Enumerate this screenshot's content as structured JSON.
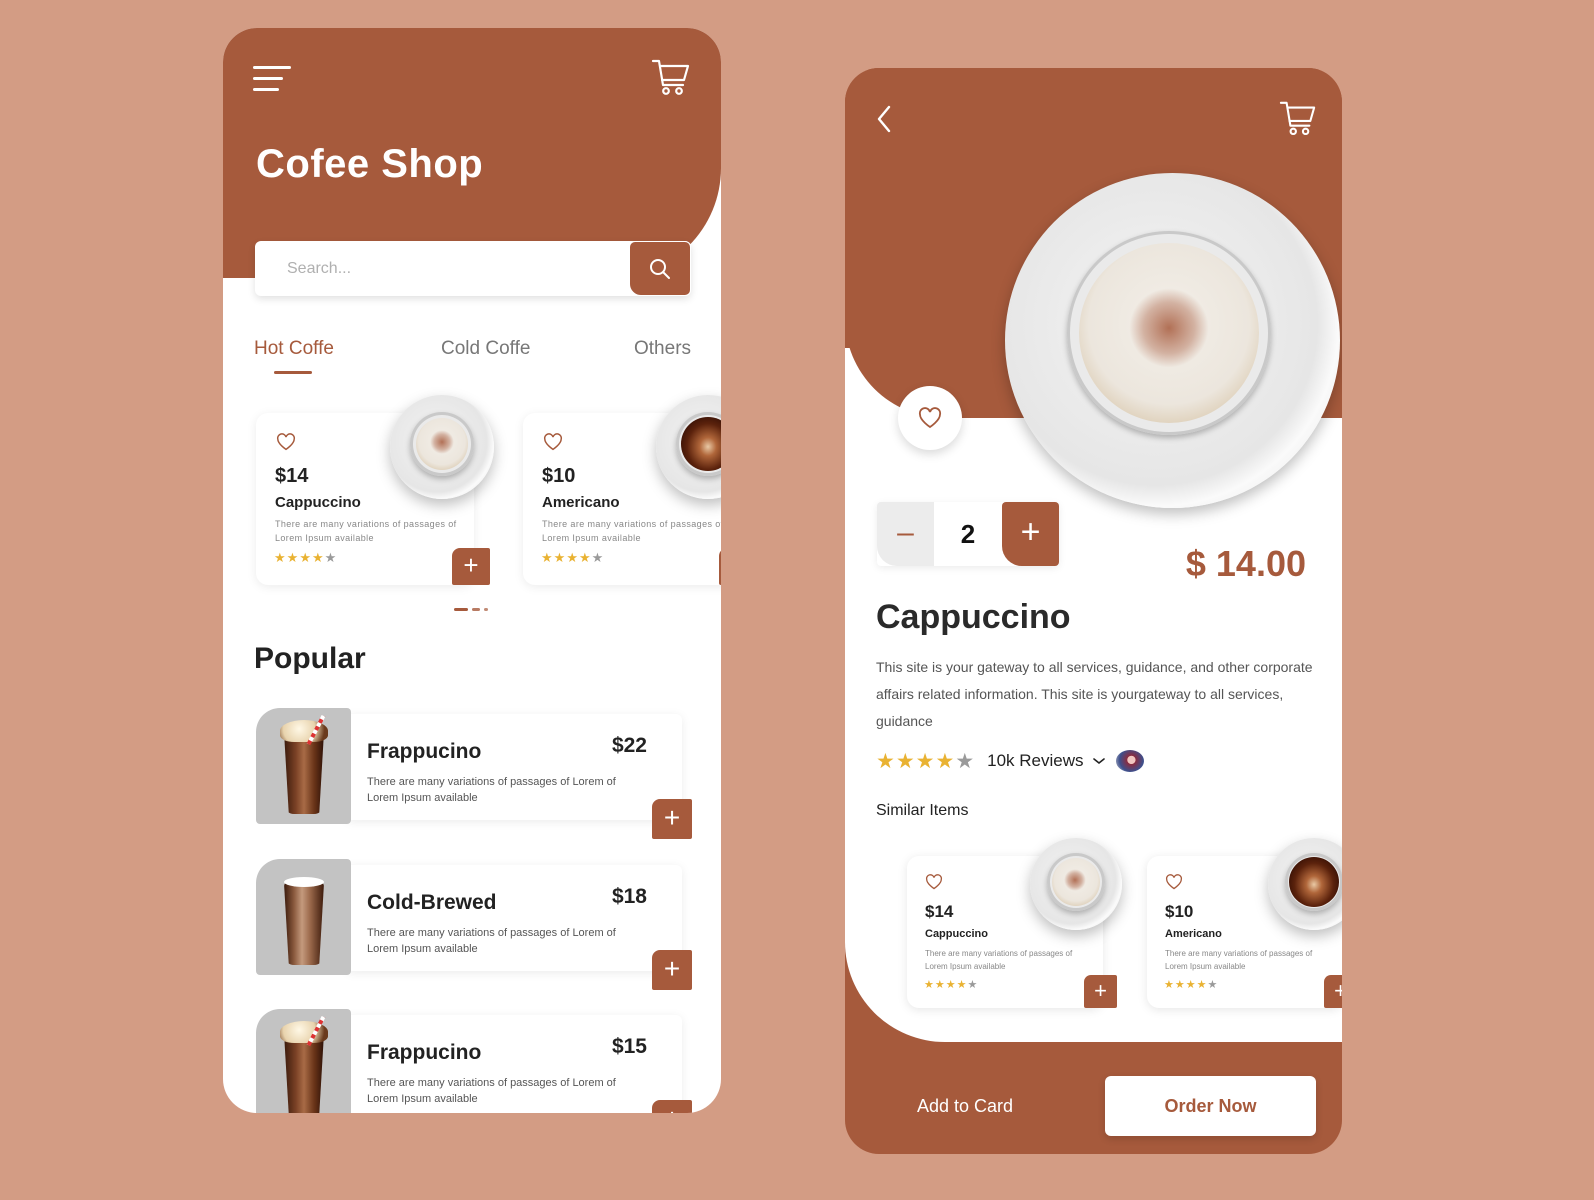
{
  "colors": {
    "brand": "#A65A3C",
    "background": "#D39C84",
    "star_on": "#E9B232",
    "star_off": "#9A9A9A"
  },
  "shop": {
    "title": "Cofee Shop",
    "search": {
      "placeholder": "Search..."
    },
    "tabs": [
      {
        "label": "Hot Coffe",
        "active": true
      },
      {
        "label": "Cold Coffe",
        "active": false
      },
      {
        "label": "Others",
        "active": false
      }
    ],
    "featured": [
      {
        "price": "$14",
        "name": "Cappuccino",
        "desc": "There are many variations of passages of Lorem Ipsum available",
        "rating": 4,
        "rating_max": 5,
        "image": "cappuccino-cup"
      },
      {
        "price": "$10",
        "name": "Americano",
        "desc": "There are many variations of passages of Lorem Ipsum available",
        "rating": 4,
        "rating_max": 5,
        "image": "americano-cup"
      }
    ],
    "carousel": {
      "pages": 3,
      "active": 0
    },
    "popular_title": "Popular",
    "popular": [
      {
        "name": "Frappucino",
        "price": "$22",
        "desc": "There are many variations of passages of Lorem of Lorem Ipsum available",
        "image": "frappuccino"
      },
      {
        "name": "Cold-Brewed",
        "price": "$18",
        "desc": "There are many variations of passages of Lorem of Lorem Ipsum available",
        "image": "cold-brew"
      },
      {
        "name": "Frappucino",
        "price": "$15",
        "desc": "There are many variations of passages of Lorem of Lorem Ipsum available",
        "image": "frappuccino"
      }
    ],
    "add_symbol": "+"
  },
  "detail": {
    "quantity": "2",
    "minus_symbol": "–",
    "plus_symbol": "+",
    "price": "$ 14.00",
    "name": "Cappuccino",
    "desc": "This site is your gateway to all services, guidance, and other corporate affairs related information. This site is yourgateway to all services, guidance",
    "rating": 4,
    "rating_max": 5,
    "reviews": "10k Reviews",
    "similar_title": "Similar Items",
    "similar": [
      {
        "price": "$14",
        "name": "Cappuccino",
        "desc": "There are many variations of passages of Lorem Ipsum available",
        "rating": 4,
        "rating_max": 5
      },
      {
        "price": "$10",
        "name": "Americano",
        "desc": "There are many variations of passages of Lorem Ipsum available",
        "rating": 4,
        "rating_max": 5
      }
    ],
    "add_to_card": "Add to Card",
    "order_now": "Order Now"
  }
}
